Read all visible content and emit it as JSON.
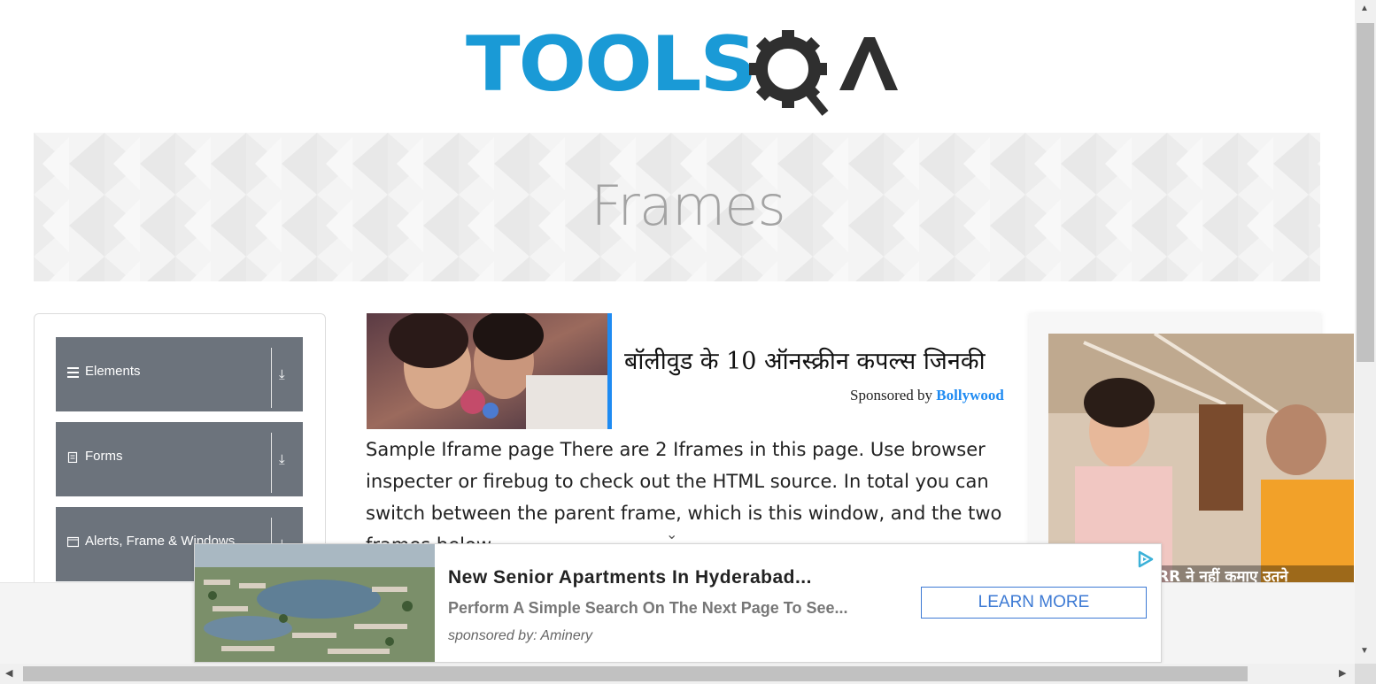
{
  "logo": {
    "text_left": "TOOLS",
    "text_right": "QA"
  },
  "banner": {
    "title": "Frames"
  },
  "sidebar": {
    "groups": [
      {
        "label": "Elements",
        "icon": "hamburger-icon"
      },
      {
        "label": "Forms",
        "icon": "form-icon"
      },
      {
        "label": "Alerts, Frame & Windows",
        "icon": "window-icon"
      }
    ]
  },
  "content_ad": {
    "headline": "बॉलीवुड के 10 ऑनस्क्रीन कपल्स जिनकी",
    "sponsored_prefix": "Sponsored by",
    "sponsor": "Bollywood"
  },
  "main": {
    "paragraph": "Sample Iframe page There are 2 Iframes in this page. Use browser inspecter or firebug to check out the HTML source. In total you can switch between the parent frame, which is this window, and the two frames below"
  },
  "right_ad": {
    "caption": "RRR ने नहीं कमाए उतने"
  },
  "anchor_ad": {
    "title": "New Senior Apartments In Hyderabad...",
    "description": "Perform A Simple Search On The Next Page To See...",
    "sponsored": "sponsored by: Aminery",
    "cta": "LEARN MORE"
  },
  "colors": {
    "brand_blue": "#1a9ad6",
    "sidebar_bg": "#6c737c",
    "link_blue": "#1f8bf2",
    "cta_blue": "#3d7ad4"
  }
}
